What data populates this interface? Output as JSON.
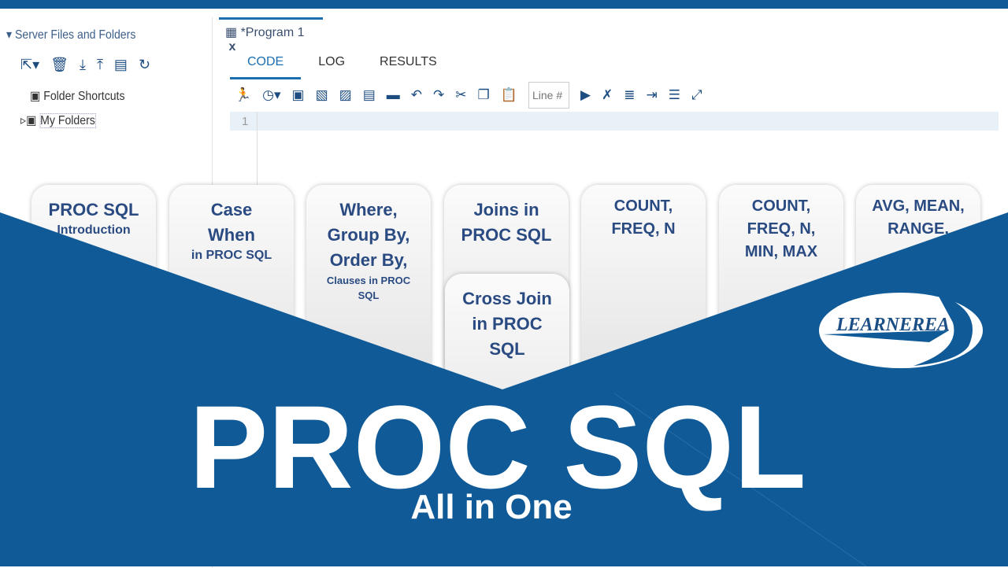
{
  "sidebar": {
    "title": "Server Files and Folders",
    "items": [
      {
        "label": "Folder Shortcuts"
      },
      {
        "label": "My Folders"
      }
    ]
  },
  "editor": {
    "tab": "*Program 1",
    "close": "x",
    "subtabs": [
      "CODE",
      "LOG",
      "RESULTS"
    ],
    "line_placeholder": "Line #",
    "line_number": "1"
  },
  "cards": [
    {
      "main": "PROC SQL",
      "sub": "Introduction"
    },
    {
      "main": "Case When",
      "sub": "in PROC SQL"
    },
    {
      "main": "Where, Group By, Order By,",
      "sub": "Clauses in PROC SQL"
    },
    {
      "main": "Joins in PROC SQL"
    },
    {
      "main": "COUNT, FREQ, N"
    },
    {
      "main": "COUNT, FREQ, N, MIN, MAX"
    },
    {
      "main": "AVG, MEAN, RANGE,"
    },
    {
      "main": "Cross Join in PROC SQL"
    }
  ],
  "title": "PROC SQL",
  "subtitle": "All in One",
  "logo": "LEARNEREA",
  "colors": {
    "brand_blue": "#0f5a97",
    "card_text": "#2a4a82"
  }
}
